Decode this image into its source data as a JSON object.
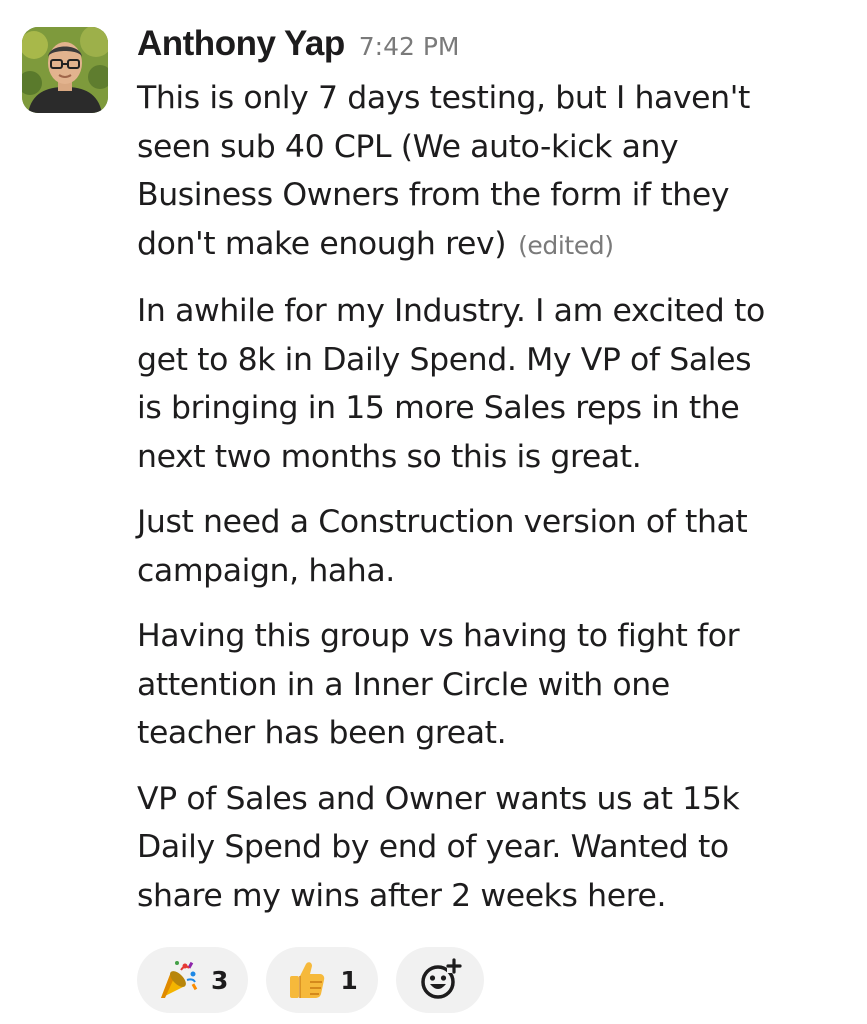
{
  "message": {
    "author": "Anthony Yap",
    "time": "7:42 PM",
    "edited_label": "(edited)",
    "paragraphs": [
      {
        "lines": [
          "This is only 7 days testing, but I haven't",
          "seen sub 40 CPL (We auto-kick any",
          "Business Owners from the form if they",
          "don't make enough rev)"
        ]
      },
      {
        "lines": [
          "In awhile for my Industry. I am excited to",
          "get to 8k in Daily Spend. My VP of Sales",
          "is bringing in 15 more Sales reps in the",
          "next two months so this is great."
        ]
      },
      {
        "lines": [
          "Just need a Construction version of that",
          "campaign, haha."
        ]
      },
      {
        "lines": [
          "Having this group vs having to fight for",
          "attention in a Inner Circle with one",
          "teacher has been great."
        ]
      },
      {
        "lines": [
          "VP of Sales and Owner wants us at 15k",
          "Daily Spend by end of year. Wanted to",
          "share my wins after 2 weeks here."
        ]
      }
    ]
  },
  "reactions": [
    {
      "icon": "party-popper-icon",
      "count": "3"
    },
    {
      "icon": "thumbs-up-icon",
      "count": "1"
    }
  ],
  "add_reaction_icon": "add-reaction-icon",
  "colors": {
    "text": "#1d1c1d",
    "muted": "#7a7a7a",
    "reaction_bg": "#f1f1f1"
  }
}
